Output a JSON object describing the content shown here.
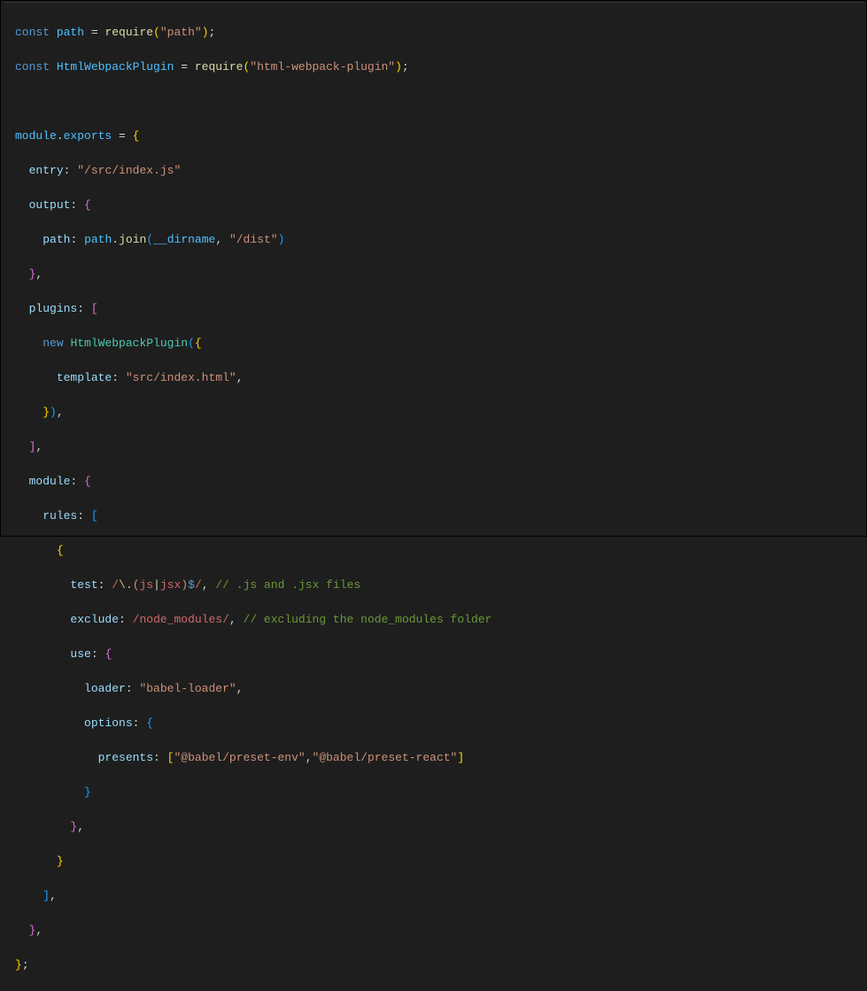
{
  "code": {
    "l1": {
      "const": "const",
      "sp": " ",
      "path": "path",
      "eq": " = ",
      "require": "require",
      "lp": "(",
      "str": "\"path\"",
      "rp": ")",
      "semi": ";"
    },
    "l2": {
      "const": "const",
      "sp": " ",
      "hwp": "HtmlWebpackPlugin",
      "eq": " = ",
      "require": "require",
      "lp": "(",
      "str": "\"html-webpack-plugin\"",
      "rp": ")",
      "semi": ";"
    },
    "l4": {
      "module": "module",
      "dot": ".",
      "exports": "exports",
      "eq": " = ",
      "lb": "{"
    },
    "l5": {
      "entry": "entry",
      "colon": ":",
      "sp": " ",
      "str": "\"/src/index.js\""
    },
    "l6": {
      "output": "output",
      "colon": ":",
      "sp": " ",
      "lb": "{"
    },
    "l7": {
      "path": "path",
      "colon": ":",
      "sp": " ",
      "pathvar": "path",
      "dot": ".",
      "join": "join",
      "lp": "(",
      "dirname": "__dirname",
      "comma": ", ",
      "str": "\"/dist\"",
      "rp": ")"
    },
    "l8": {
      "rb": "}",
      "comma": ","
    },
    "l9": {
      "plugins": "plugins",
      "colon": ":",
      "sp": " ",
      "lbr": "["
    },
    "l10": {
      "new": "new",
      "sp": " ",
      "cls": "HtmlWebpackPlugin",
      "lp": "(",
      "lb": "{"
    },
    "l11": {
      "template": "template",
      "colon": ":",
      "sp": " ",
      "str": "\"src/index.html\"",
      "comma": ","
    },
    "l12": {
      "rb": "}",
      "rp": ")",
      "comma": ","
    },
    "l13": {
      "rbr": "]",
      "comma": ","
    },
    "l14": {
      "module": "module",
      "colon": ":",
      "sp": " ",
      "lb": "{"
    },
    "l15": {
      "rules": "rules",
      "colon": ":",
      "sp": " ",
      "lbr": "["
    },
    "l16": {
      "lb": "{"
    },
    "l17": {
      "test": "test",
      "colon": ":",
      "sp": " ",
      "re_open": "/",
      "re_esc": "\\.",
      "re_lp": "(",
      "re_js": "js",
      "re_pipe": "|",
      "re_jsx": "jsx",
      "re_rp": ")",
      "re_dollar": "$",
      "re_close": "/",
      "comma": ", ",
      "comment": "// .js and .jsx files"
    },
    "l18": {
      "exclude": "exclude",
      "colon": ":",
      "sp": " ",
      "re_open": "/",
      "re_body": "node_modules",
      "re_close": "/",
      "comma": ", ",
      "comment": "// excluding the node_modules folder"
    },
    "l19": {
      "use": "use",
      "colon": ":",
      "sp": " ",
      "lb": "{"
    },
    "l20": {
      "loader": "loader",
      "colon": ":",
      "sp": " ",
      "str": "\"babel-loader\"",
      "comma": ","
    },
    "l21": {
      "options": "options",
      "colon": ":",
      "sp": " ",
      "lb": "{"
    },
    "l22": {
      "presents": "presents",
      "colon": ":",
      "sp": " ",
      "lbr": "[",
      "str1": "\"@babel/preset-env\"",
      "comma": ",",
      "str2": "\"@babel/preset-react\"",
      "rbr": "]"
    },
    "l23": {
      "rb": "}"
    },
    "l24": {
      "rb": "}",
      "comma": ","
    },
    "l25": {
      "rb": "}"
    },
    "l26": {
      "rbr": "]",
      "comma": ","
    },
    "l27": {
      "rb": "}",
      "comma": ","
    },
    "l28": {
      "rb": "}",
      "semi": ";"
    }
  }
}
